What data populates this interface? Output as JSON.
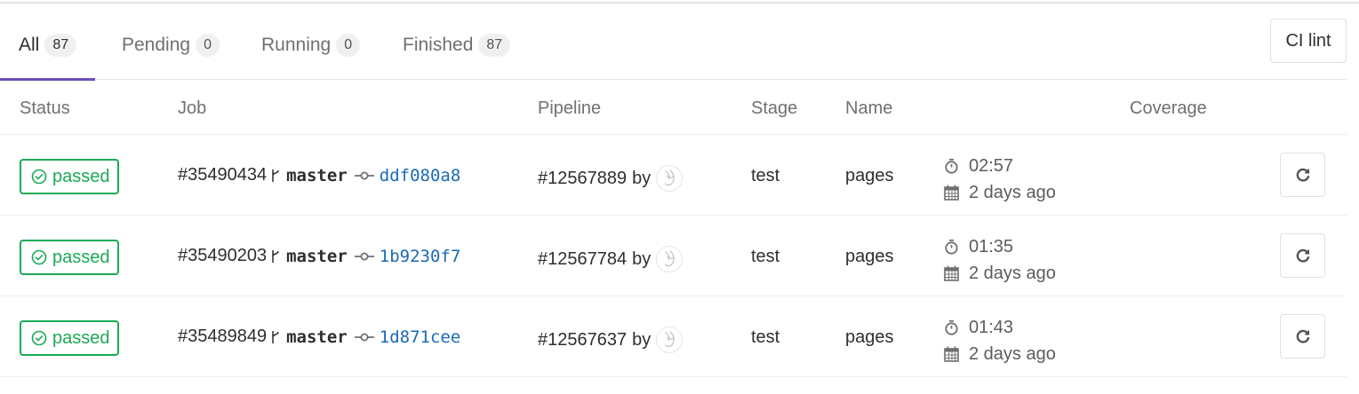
{
  "tabs": [
    {
      "label": "All",
      "count": "87",
      "active": true
    },
    {
      "label": "Pending",
      "count": "0",
      "active": false
    },
    {
      "label": "Running",
      "count": "0",
      "active": false
    },
    {
      "label": "Finished",
      "count": "87",
      "active": false
    }
  ],
  "ci_lint_label": "CI lint",
  "columns": {
    "status": "Status",
    "job": "Job",
    "pipeline": "Pipeline",
    "stage": "Stage",
    "name": "Name",
    "coverage": "Coverage"
  },
  "jobs": [
    {
      "status": "passed",
      "job_id": "#35490434",
      "branch": "master",
      "sha": "ddf080a8",
      "pipeline_id": "#12567889",
      "by": "by",
      "stage": "test",
      "name": "pages",
      "duration": "02:57",
      "finished": "2 days ago"
    },
    {
      "status": "passed",
      "job_id": "#35490203",
      "branch": "master",
      "sha": "1b9230f7",
      "pipeline_id": "#12567784",
      "by": "by",
      "stage": "test",
      "name": "pages",
      "duration": "01:35",
      "finished": "2 days ago"
    },
    {
      "status": "passed",
      "job_id": "#35489849",
      "branch": "master",
      "sha": "1d871cee",
      "pipeline_id": "#12567637",
      "by": "by",
      "stage": "test",
      "name": "pages",
      "duration": "01:43",
      "finished": "2 days ago"
    }
  ],
  "icons": {
    "status": "check-circle-icon",
    "branch": "branch-icon",
    "commit": "commit-icon",
    "avatar": "user-avatar",
    "duration": "timer-icon",
    "finished": "calendar-icon",
    "retry": "retry-icon"
  },
  "colors": {
    "accent_tab": "#6b4fbb",
    "status_passed": "#1aaa55",
    "sha_link": "#1b69b6"
  }
}
